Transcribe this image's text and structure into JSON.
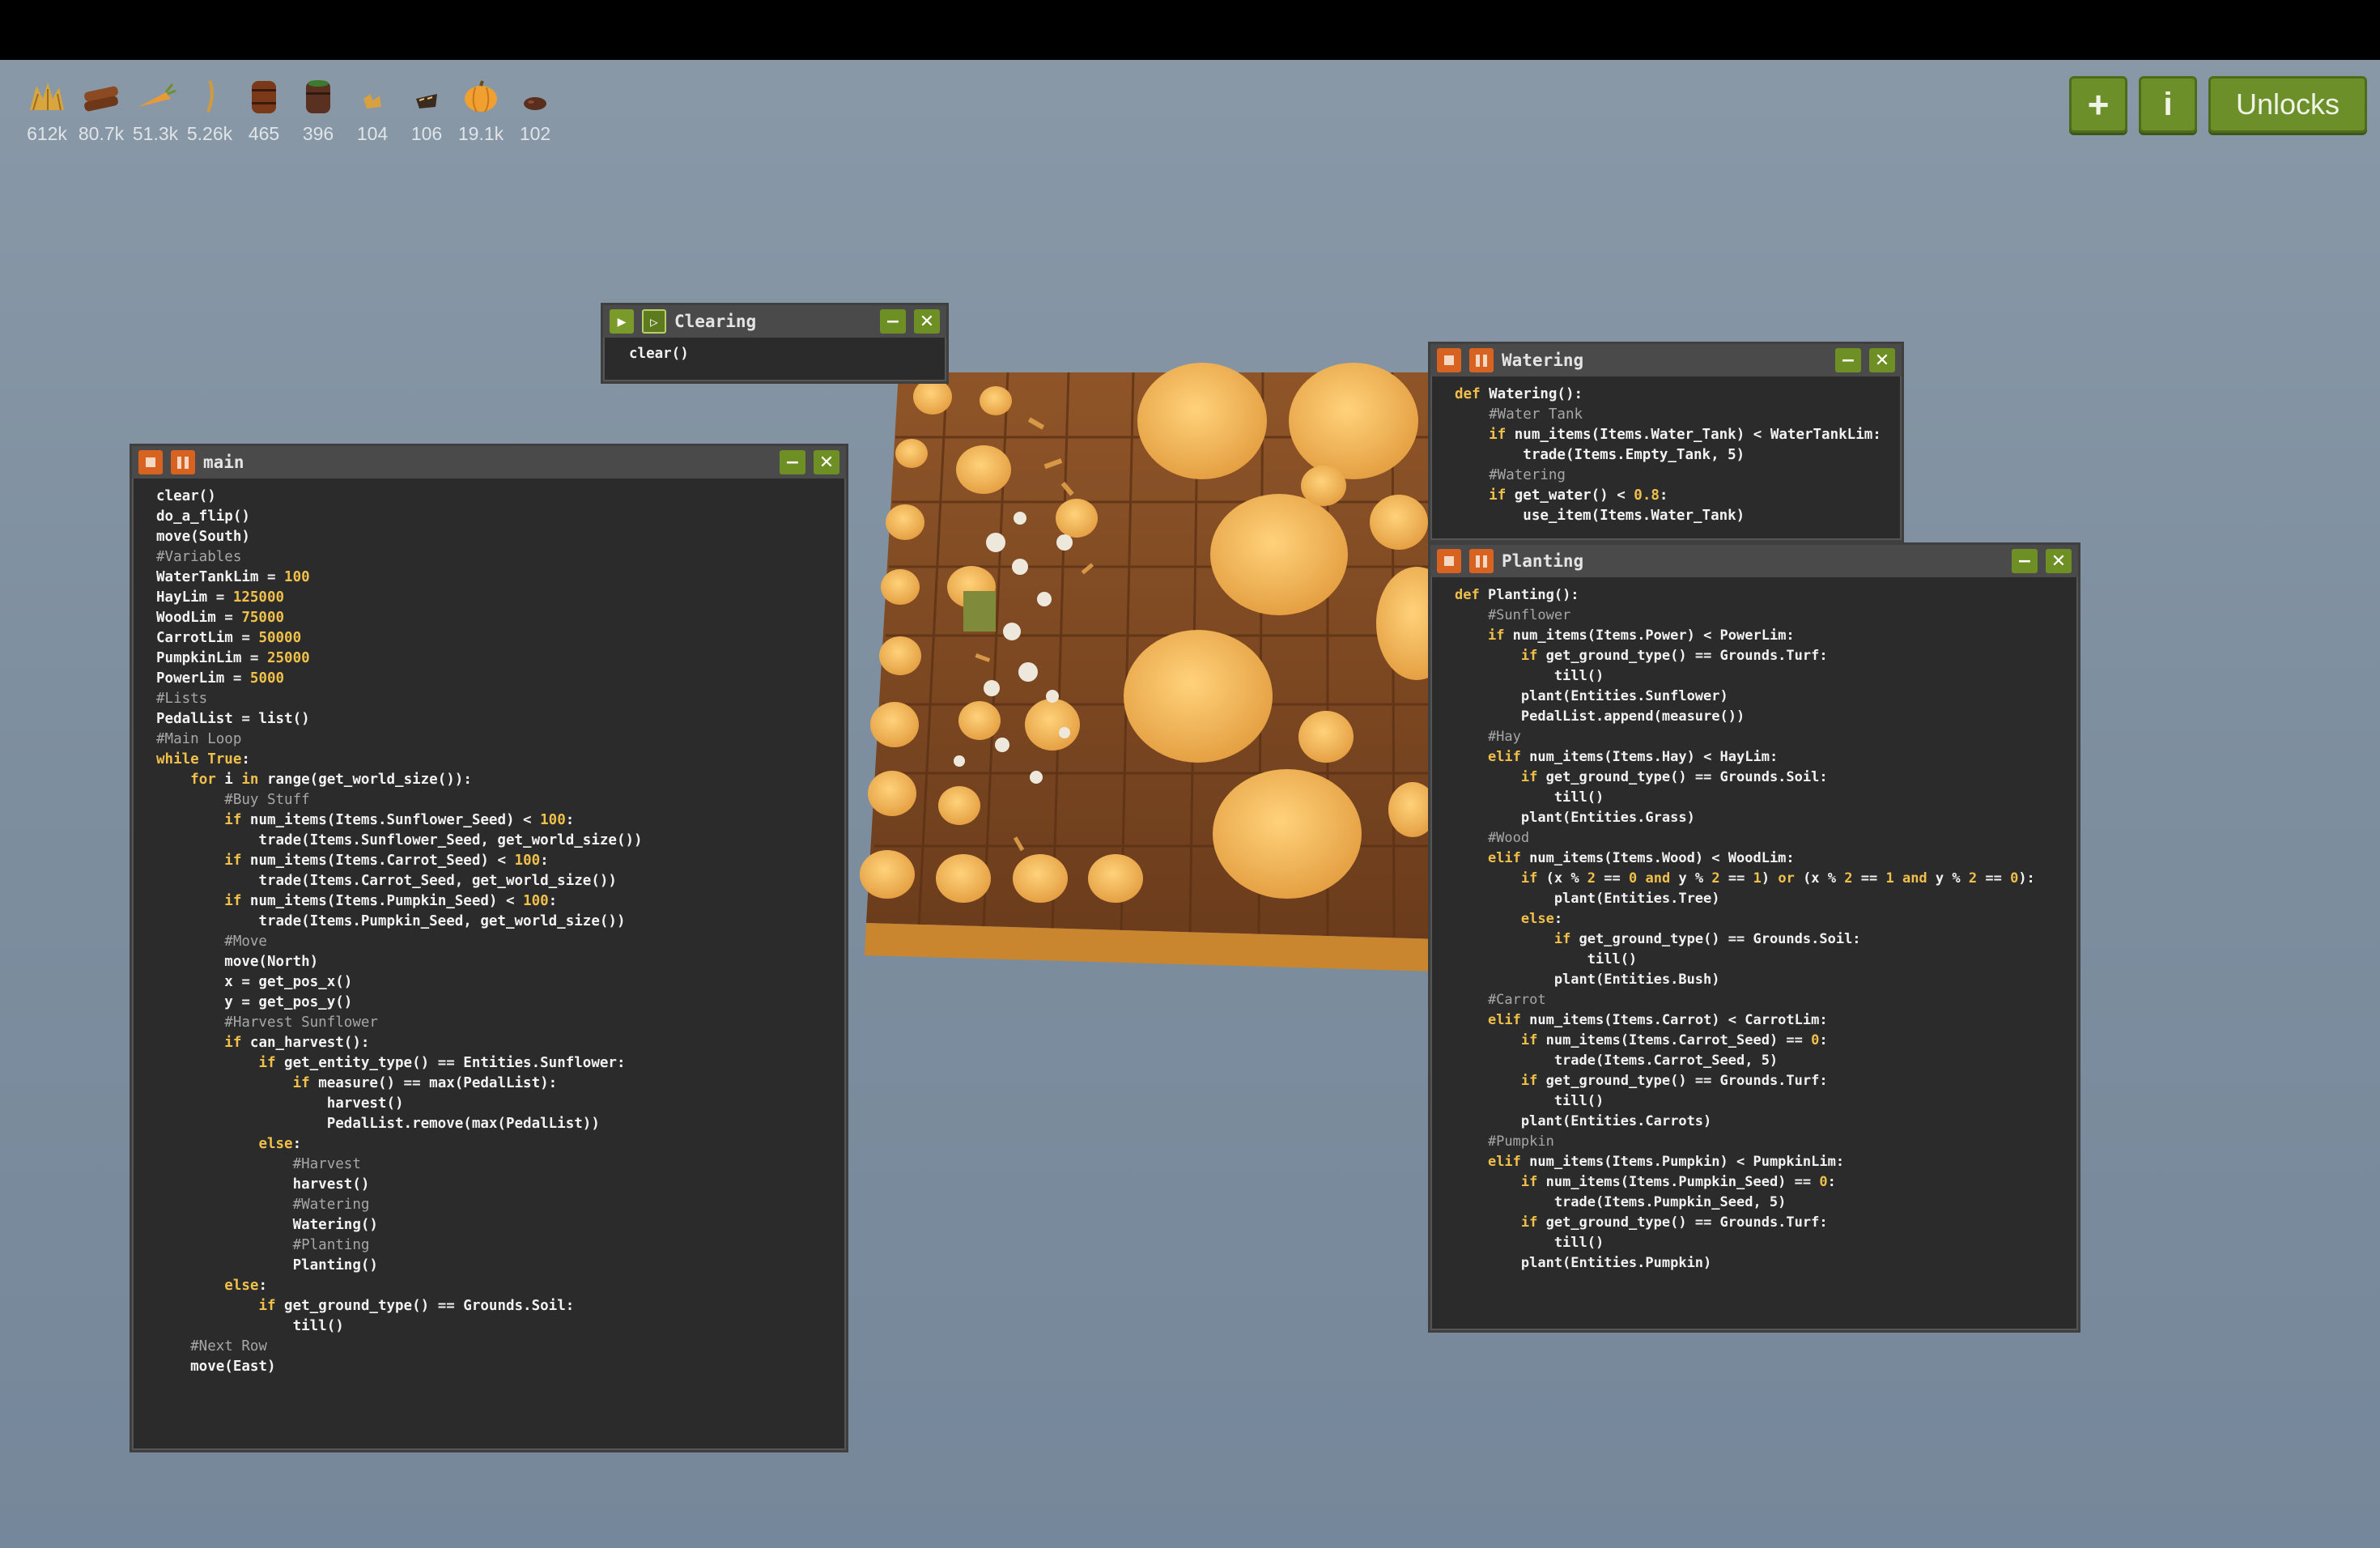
{
  "resources": [
    {
      "icon": "hay-icon",
      "count": "612k"
    },
    {
      "icon": "wood-icon",
      "count": "80.7k"
    },
    {
      "icon": "carrot-icon",
      "count": "51.3k"
    },
    {
      "icon": "sunflower-seed-icon",
      "count": "5.26k"
    },
    {
      "icon": "water-barrel-icon",
      "count": "465"
    },
    {
      "icon": "green-barrel-icon",
      "count": "396"
    },
    {
      "icon": "seed-bag-icon",
      "count": "104"
    },
    {
      "icon": "carrot-seed-icon",
      "count": "106"
    },
    {
      "icon": "pumpkin-icon",
      "count": "19.1k"
    },
    {
      "icon": "pumpkin-seed-icon",
      "count": "102"
    }
  ],
  "buttons": {
    "add": "+",
    "info": "i",
    "unlocks": "Unlocks"
  },
  "windows": {
    "clearing": {
      "title": "Clearing",
      "lines": [
        "clear()"
      ]
    },
    "main": {
      "title": "main",
      "lines": [
        "clear()",
        "do_a_flip()",
        "move(South)",
        "#Variables",
        "WaterTankLim = 100",
        "HayLim = 125000",
        "WoodLim = 75000",
        "CarrotLim = 50000",
        "PumpkinLim = 25000",
        "PowerLim = 5000",
        "#Lists",
        "PedalList = list()",
        "#Main Loop",
        "while True:",
        "    for i in range(get_world_size()):",
        "        #Buy Stuff",
        "        if num_items(Items.Sunflower_Seed) < 100:",
        "            trade(Items.Sunflower_Seed, get_world_size())",
        "        if num_items(Items.Carrot_Seed) < 100:",
        "            trade(Items.Carrot_Seed, get_world_size())",
        "        if num_items(Items.Pumpkin_Seed) < 100:",
        "            trade(Items.Pumpkin_Seed, get_world_size())",
        "        #Move",
        "        move(North)",
        "        x = get_pos_x()",
        "        y = get_pos_y()",
        "        #Harvest Sunflower",
        "        if can_harvest():",
        "            if get_entity_type() == Entities.Sunflower:",
        "                if measure() == max(PedalList):",
        "                    harvest()",
        "                    PedalList.remove(max(PedalList))",
        "            else:",
        "                #Harvest",
        "                harvest()",
        "                #Watering",
        "                Watering()",
        "                #Planting",
        "                Planting()",
        "        else:",
        "            if get_ground_type() == Grounds.Soil:",
        "                till()",
        "    #Next Row",
        "    move(East)"
      ]
    },
    "watering": {
      "title": "Watering",
      "lines": [
        "def Watering():",
        "    #Water Tank",
        "    if num_items(Items.Water_Tank) < WaterTankLim:",
        "        trade(Items.Empty_Tank, 5)",
        "    #Watering",
        "    if get_water() < 0.8:",
        "        use_item(Items.Water_Tank)"
      ]
    },
    "planting": {
      "title": "Planting",
      "lines": [
        "def Planting():",
        "    #Sunflower",
        "    if num_items(Items.Power) < PowerLim:",
        "        if get_ground_type() == Grounds.Turf:",
        "            till()",
        "        plant(Entities.Sunflower)",
        "        PedalList.append(measure())",
        "    #Hay",
        "    elif num_items(Items.Hay) < HayLim:",
        "        if get_ground_type() == Grounds.Soil:",
        "            till()",
        "        plant(Entities.Grass)",
        "    #Wood",
        "    elif num_items(Items.Wood) < WoodLim:",
        "        if (x % 2 == 0 and y % 2 == 1) or (x % 2 == 1 and y % 2 == 0):",
        "            plant(Entities.Tree)",
        "        else:",
        "            if get_ground_type() == Grounds.Soil:",
        "                till()",
        "            plant(Entities.Bush)",
        "    #Carrot",
        "    elif num_items(Items.Carrot) < CarrotLim:",
        "        if num_items(Items.Carrot_Seed) == 0:",
        "            trade(Items.Carrot_Seed, 5)",
        "        if get_ground_type() == Grounds.Turf:",
        "            till()",
        "        plant(Entities.Carrots)",
        "    #Pumpkin",
        "    elif num_items(Items.Pumpkin) < PumpkinLim:",
        "        if num_items(Items.Pumpkin_Seed) == 0:",
        "            trade(Items.Pumpkin_Seed, 5)",
        "        if get_ground_type() == Grounds.Turf:",
        "            till()",
        "        plant(Entities.Pumpkin)"
      ]
    }
  },
  "colors": {
    "keyword": "#f0c04a",
    "comment": "#a7a7a7",
    "accent_green": "#6c8f2a",
    "stop_orange": "#d8621f",
    "pumpkin": "#f0b452",
    "soil": "#8a4f24"
  }
}
